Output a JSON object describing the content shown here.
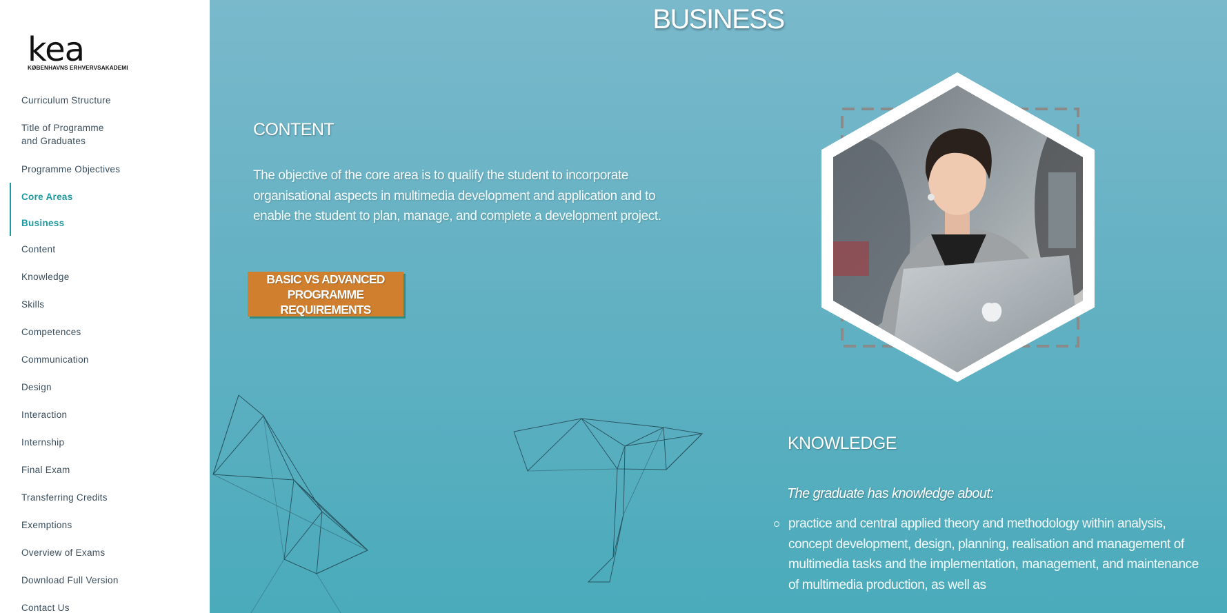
{
  "logo": {
    "mark": "kea",
    "subtitle": "KØBENHAVNS ERHVERVSAKADEMI"
  },
  "sidebar": {
    "items": [
      {
        "label": "Curriculum Structure",
        "active": false
      },
      {
        "label": "Title of Programme\nand Graduates",
        "active": false
      },
      {
        "label": "Programme Objectives",
        "active": false
      },
      {
        "label": "Core Areas",
        "active": true
      },
      {
        "label": "Business",
        "active": true
      },
      {
        "label": "Content",
        "active": false
      },
      {
        "label": "Knowledge",
        "active": false
      },
      {
        "label": "Skills",
        "active": false
      },
      {
        "label": "Competences",
        "active": false
      },
      {
        "label": "Communication",
        "active": false
      },
      {
        "label": "Design",
        "active": false
      },
      {
        "label": "Interaction",
        "active": false
      },
      {
        "label": "Internship",
        "active": false
      },
      {
        "label": "Final Exam",
        "active": false
      },
      {
        "label": "Transferring Credits",
        "active": false
      },
      {
        "label": "Exemptions",
        "active": false
      },
      {
        "label": "Overview of Exams",
        "active": false
      },
      {
        "label": "Download Full Version",
        "active": false
      },
      {
        "label": "Contact Us",
        "active": false
      }
    ]
  },
  "main": {
    "title": "BUSINESS",
    "content": {
      "heading": "CONTENT",
      "text": "The objective of the core area is to qualify the student to incorporate organisational aspects in multimedia development and application and to enable the student to plan, manage, and complete a development project."
    },
    "cta_button": "BASIC VS ADVANCED\nPROGRAMME REQUIREMENTS",
    "knowledge": {
      "heading": "KNOWLEDGE",
      "intro": "The graduate has knowledge about:",
      "items": [
        "practice and central applied theory and methodology within analysis, concept development, design, planning, realisation and management of multimedia tasks and the implementation, management, and maintenance of multimedia production, as well as"
      ]
    },
    "photo": {
      "icon": "student-with-laptop-photo"
    }
  },
  "colors": {
    "accent": "#1a9aa0",
    "button": "#cf7f2e",
    "background_top": "#7ab9cc",
    "background_bottom": "#4aabbb"
  }
}
